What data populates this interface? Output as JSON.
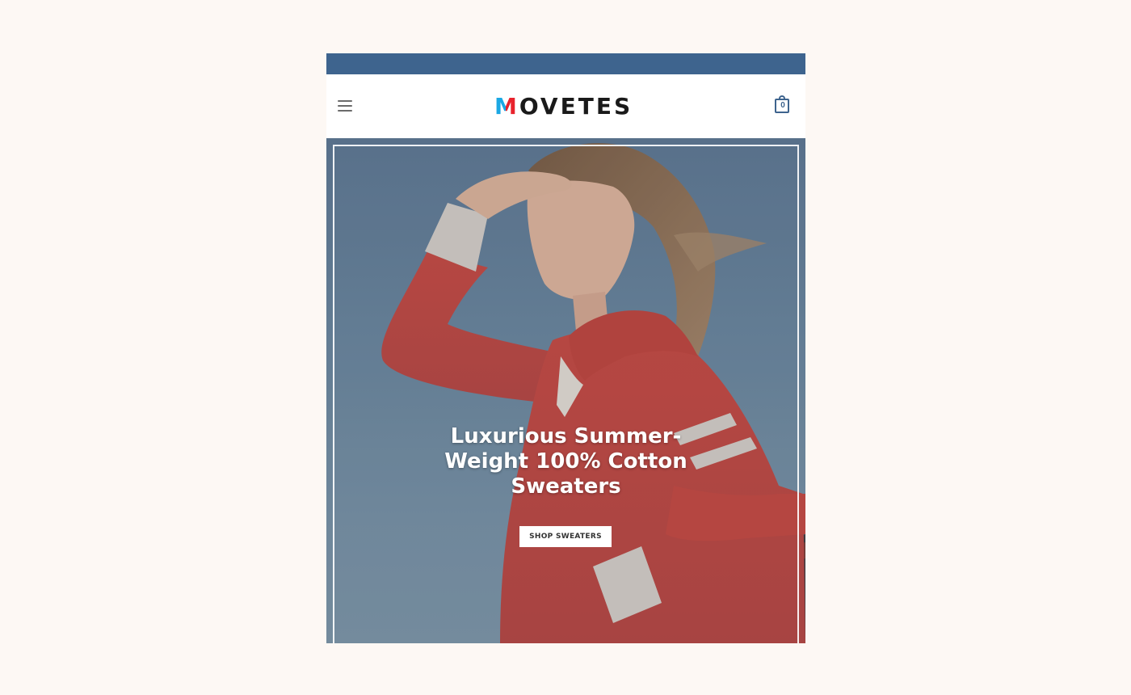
{
  "colors": {
    "page_background": "#fdf8f4",
    "top_bar": "#3e648e",
    "accent": "#3e648e",
    "logo_blue": "#1ba8e4",
    "logo_red": "#e8222c",
    "sweater_red": "#d2473d"
  },
  "header": {
    "menu_icon": "hamburger-menu-icon",
    "logo": {
      "first_letter": "M",
      "rest": "OVETES"
    },
    "cart": {
      "icon": "shopping-bag-icon",
      "count": "0"
    }
  },
  "hero": {
    "headline_line1": "Luxurious Summer-",
    "headline_line2": "Weight 100% Cotton",
    "headline_line3": "Sweaters",
    "cta_label": "SHOP SWEATERS"
  }
}
